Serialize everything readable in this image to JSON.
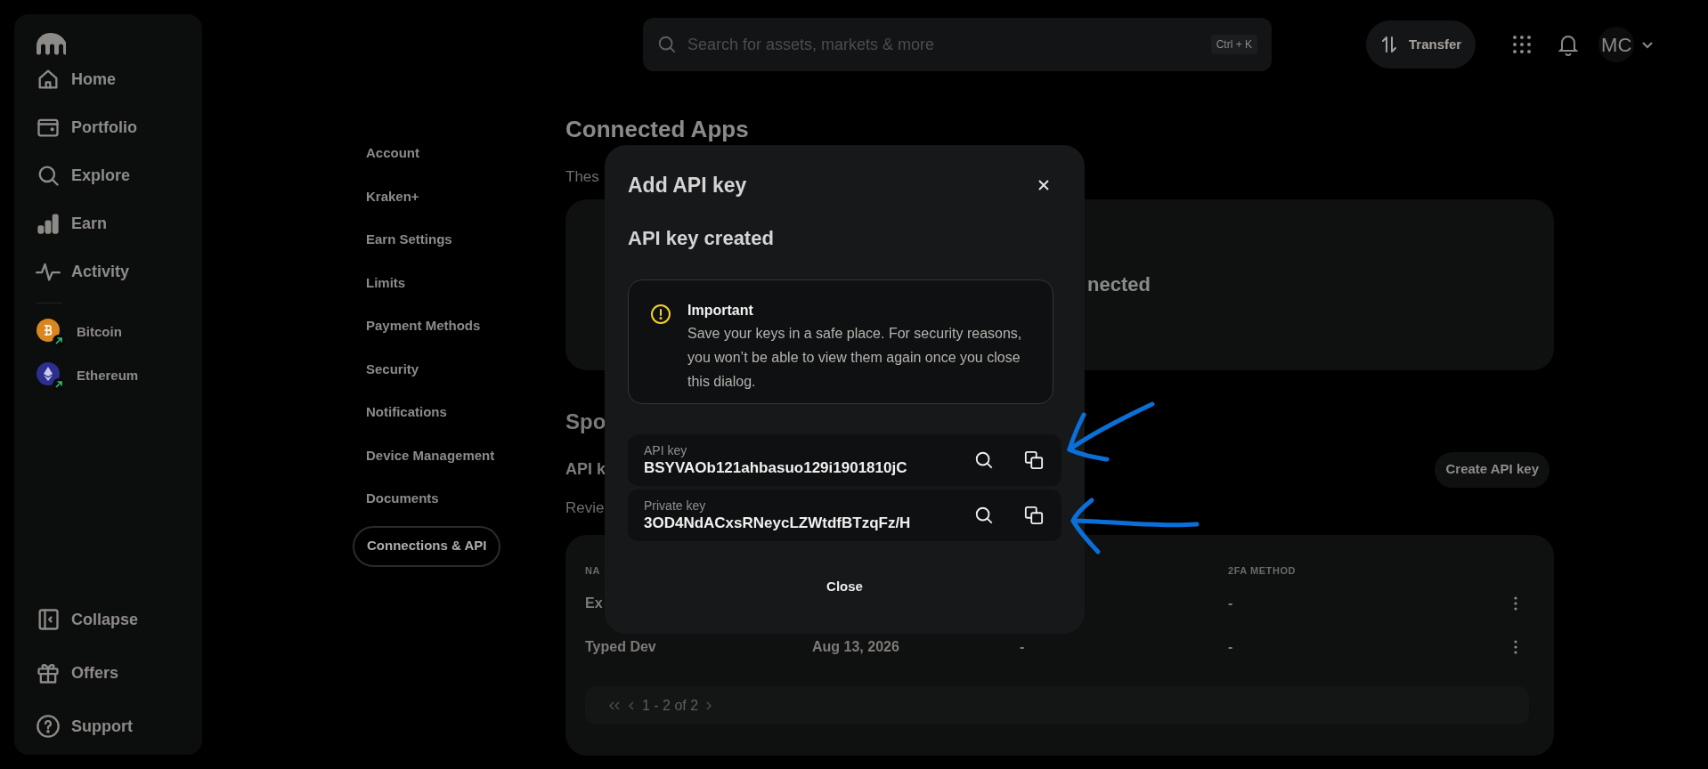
{
  "sidebar": {
    "nav": [
      {
        "label": "Home"
      },
      {
        "label": "Portfolio"
      },
      {
        "label": "Explore"
      },
      {
        "label": "Earn"
      },
      {
        "label": "Activity"
      }
    ],
    "assets": [
      {
        "name": "Bitcoin",
        "color": "#d9861e"
      },
      {
        "name": "Ethereum",
        "color": "#2c2f8f"
      }
    ],
    "footer": [
      {
        "label": "Collapse"
      },
      {
        "label": "Offers"
      },
      {
        "label": "Support"
      }
    ]
  },
  "search": {
    "placeholder": "Search for assets, markets & more",
    "shortcut": "Ctrl + K"
  },
  "header": {
    "transfer": "Transfer",
    "avatar": "MC"
  },
  "settings_nav": [
    {
      "label": "Account",
      "selected": false
    },
    {
      "label": "Kraken+",
      "selected": false
    },
    {
      "label": "Earn Settings",
      "selected": false
    },
    {
      "label": "Limits",
      "selected": false
    },
    {
      "label": "Payment Methods",
      "selected": false
    },
    {
      "label": "Security",
      "selected": false
    },
    {
      "label": "Notifications",
      "selected": false
    },
    {
      "label": "Device Management",
      "selected": false
    },
    {
      "label": "Documents",
      "selected": false
    },
    {
      "label": "Connections & API",
      "selected": true
    }
  ],
  "page": {
    "title": "Connected Apps",
    "subtitle": "Thes",
    "apps_card_text": "nected",
    "section_title": "Spo",
    "api_title": "API k",
    "api_description": "Revie",
    "create_button": "Create API key",
    "table": {
      "column_1": "NA",
      "column_4": "2FA METHOD",
      "rows": [
        {
          "name": "Ex",
          "two_fa": "-"
        },
        {
          "name": "Typed Dev",
          "date": "Aug 13, 2026",
          "column_3": "-",
          "two_fa": "-"
        }
      ],
      "pagination": "1 - 2 of 2"
    }
  },
  "dialog": {
    "title": "Add API key",
    "subtitle": "API key created",
    "notice": {
      "title": "Important",
      "text": "Save your keys in a safe place. For security reasons, you won’t be able to view them again once you close this dialog."
    },
    "keys": [
      {
        "label": "API key",
        "value": "BSYVAOb121ahbasuo129i1901810jC"
      },
      {
        "label": "Private key",
        "value": "3OD4NdACxsRNeycLZWtdfBTzqFz/H"
      }
    ],
    "close": "Close"
  }
}
